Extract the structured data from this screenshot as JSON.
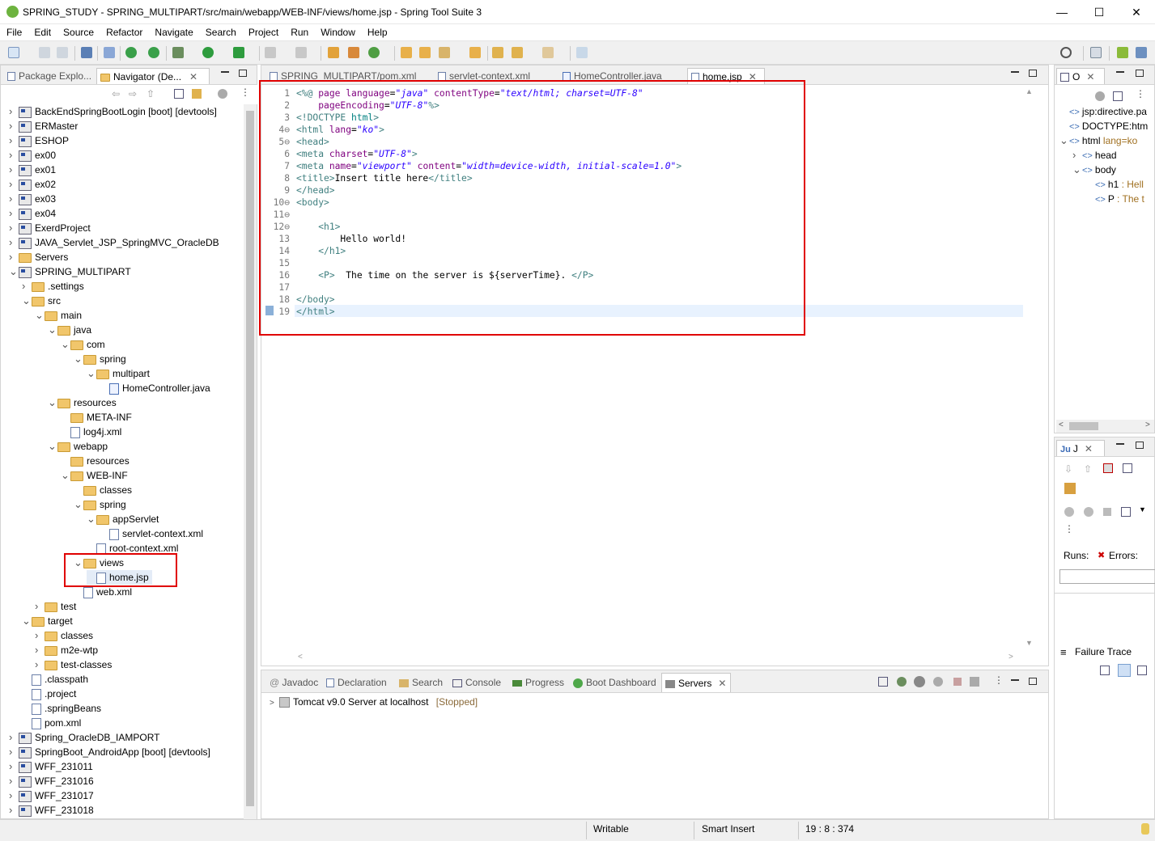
{
  "window": {
    "title": "SPRING_STUDY - SPRING_MULTIPART/src/main/webapp/WEB-INF/views/home.jsp - Spring Tool Suite 3",
    "min": "—",
    "max": "☐",
    "close": "✕"
  },
  "menu": [
    "File",
    "Edit",
    "Source",
    "Refactor",
    "Navigate",
    "Search",
    "Project",
    "Run",
    "Window",
    "Help"
  ],
  "left_tabs": {
    "package": "Package Explo...",
    "navigator": "Navigator (De..."
  },
  "tree": [
    {
      "label": "BackEndSpringBootLogin [boot] [devtools]",
      "level": 0,
      "icon": "proj",
      "tw": ">"
    },
    {
      "label": "ERMaster",
      "level": 0,
      "icon": "proj",
      "tw": ">"
    },
    {
      "label": "ESHOP",
      "level": 0,
      "icon": "proj",
      "tw": ">"
    },
    {
      "label": "ex00",
      "level": 0,
      "icon": "proj",
      "tw": ">"
    },
    {
      "label": "ex01",
      "level": 0,
      "icon": "proj",
      "tw": ">"
    },
    {
      "label": "ex02",
      "level": 0,
      "icon": "proj",
      "tw": ">"
    },
    {
      "label": "ex03",
      "level": 0,
      "icon": "proj",
      "tw": ">"
    },
    {
      "label": "ex04",
      "level": 0,
      "icon": "proj",
      "tw": ">"
    },
    {
      "label": "ExerdProject",
      "level": 0,
      "icon": "proj",
      "tw": ">"
    },
    {
      "label": "JAVA_Servlet_JSP_SpringMVC_OracleDB",
      "level": 0,
      "icon": "proj",
      "tw": ">"
    },
    {
      "label": "Servers",
      "level": 0,
      "icon": "fold",
      "tw": ">"
    },
    {
      "label": "SPRING_MULTIPART",
      "level": 0,
      "icon": "proj",
      "tw": "v"
    },
    {
      "label": ".settings",
      "level": 1,
      "icon": "fold",
      "tw": ">"
    },
    {
      "label": "src",
      "level": 1,
      "icon": "fold",
      "tw": "v"
    },
    {
      "label": "main",
      "level": 2,
      "icon": "fold",
      "tw": "v"
    },
    {
      "label": "java",
      "level": 3,
      "icon": "fold",
      "tw": "v"
    },
    {
      "label": "com",
      "level": 4,
      "icon": "fold",
      "tw": "v"
    },
    {
      "label": "spring",
      "level": 5,
      "icon": "fold",
      "tw": "v"
    },
    {
      "label": "multipart",
      "level": 6,
      "icon": "fold",
      "tw": "v"
    },
    {
      "label": "HomeController.java",
      "level": 7,
      "icon": "jfile",
      "tw": ""
    },
    {
      "label": "resources",
      "level": 3,
      "icon": "fold",
      "tw": "v"
    },
    {
      "label": "META-INF",
      "level": 4,
      "icon": "fold",
      "tw": ""
    },
    {
      "label": "log4j.xml",
      "level": 4,
      "icon": "file",
      "tw": ""
    },
    {
      "label": "webapp",
      "level": 3,
      "icon": "fold",
      "tw": "v"
    },
    {
      "label": "resources",
      "level": 4,
      "icon": "fold",
      "tw": ""
    },
    {
      "label": "WEB-INF",
      "level": 4,
      "icon": "fold",
      "tw": "v"
    },
    {
      "label": "classes",
      "level": 5,
      "icon": "fold",
      "tw": ""
    },
    {
      "label": "spring",
      "level": 5,
      "icon": "fold",
      "tw": "v"
    },
    {
      "label": "appServlet",
      "level": 6,
      "icon": "fold",
      "tw": "v"
    },
    {
      "label": "servlet-context.xml",
      "level": 7,
      "icon": "file",
      "tw": ""
    },
    {
      "label": "root-context.xml",
      "level": 6,
      "icon": "file",
      "tw": ""
    },
    {
      "label": "views",
      "level": 5,
      "icon": "fold",
      "tw": "v"
    },
    {
      "label": "home.jsp",
      "level": 6,
      "icon": "file",
      "tw": "",
      "selected": true
    },
    {
      "label": "web.xml",
      "level": 5,
      "icon": "file",
      "tw": ""
    },
    {
      "label": "test",
      "level": 2,
      "icon": "fold",
      "tw": ">"
    },
    {
      "label": "target",
      "level": 1,
      "icon": "fold",
      "tw": "v"
    },
    {
      "label": "classes",
      "level": 2,
      "icon": "fold",
      "tw": ">"
    },
    {
      "label": "m2e-wtp",
      "level": 2,
      "icon": "fold",
      "tw": ">"
    },
    {
      "label": "test-classes",
      "level": 2,
      "icon": "fold",
      "tw": ">"
    },
    {
      "label": ".classpath",
      "level": 1,
      "icon": "file",
      "tw": ""
    },
    {
      "label": ".project",
      "level": 1,
      "icon": "file",
      "tw": ""
    },
    {
      "label": ".springBeans",
      "level": 1,
      "icon": "file",
      "tw": ""
    },
    {
      "label": "pom.xml",
      "level": 1,
      "icon": "file",
      "tw": ""
    },
    {
      "label": "Spring_OracleDB_IAMPORT",
      "level": 0,
      "icon": "proj",
      "tw": ">"
    },
    {
      "label": "SpringBoot_AndroidApp [boot] [devtools]",
      "level": 0,
      "icon": "proj",
      "tw": ">"
    },
    {
      "label": "WFF_231011",
      "level": 0,
      "icon": "proj",
      "tw": ">"
    },
    {
      "label": "WFF_231016",
      "level": 0,
      "icon": "proj",
      "tw": ">"
    },
    {
      "label": "WFF_231017",
      "level": 0,
      "icon": "proj",
      "tw": ">"
    },
    {
      "label": "WFF_231018",
      "level": 0,
      "icon": "proj",
      "tw": ">"
    }
  ],
  "editor_tabs": [
    "SPRING_MULTIPART/pom.xml",
    "servlet-context.xml",
    "HomeController.java",
    "home.jsp"
  ],
  "code_lines": [
    {
      "n": "1",
      "tokens": [
        [
          "t",
          "<%@ "
        ],
        [
          "a",
          "page "
        ],
        [
          "a",
          "language"
        ],
        [
          "k",
          "="
        ],
        [
          "v",
          "\"java\""
        ],
        [
          "k",
          " "
        ],
        [
          "a",
          "contentType"
        ],
        [
          "k",
          "="
        ],
        [
          "v",
          "\"text/html; charset=UTF-8\""
        ]
      ]
    },
    {
      "n": "2",
      "tokens": [
        [
          "k",
          "    "
        ],
        [
          "a",
          "pageEncoding"
        ],
        [
          "k",
          "="
        ],
        [
          "v",
          "\"UTF-8\""
        ],
        [
          "t",
          "%>"
        ]
      ]
    },
    {
      "n": "3",
      "tokens": [
        [
          "t",
          "<!DOCTYPE "
        ],
        [
          "d",
          "html"
        ],
        [
          "t",
          ">"
        ]
      ]
    },
    {
      "n": "4⊖",
      "tokens": [
        [
          "t",
          "<html "
        ],
        [
          "a",
          "lang"
        ],
        [
          "k",
          "="
        ],
        [
          "v",
          "\"ko\""
        ],
        [
          "t",
          ">"
        ]
      ]
    },
    {
      "n": "5⊖",
      "tokens": [
        [
          "t",
          "<head>"
        ]
      ]
    },
    {
      "n": "6",
      "tokens": [
        [
          "t",
          "<meta "
        ],
        [
          "a",
          "charset"
        ],
        [
          "k",
          "="
        ],
        [
          "v",
          "\"UTF-8\""
        ],
        [
          "t",
          ">"
        ]
      ]
    },
    {
      "n": "7",
      "tokens": [
        [
          "t",
          "<meta "
        ],
        [
          "a",
          "name"
        ],
        [
          "k",
          "="
        ],
        [
          "v",
          "\"viewport\""
        ],
        [
          "k",
          " "
        ],
        [
          "a",
          "content"
        ],
        [
          "k",
          "="
        ],
        [
          "v",
          "\"width=device-width, initial-scale=1.0\""
        ],
        [
          "t",
          ">"
        ]
      ]
    },
    {
      "n": "8",
      "tokens": [
        [
          "t",
          "<title>"
        ],
        [
          "k",
          "Insert title here"
        ],
        [
          "t",
          "</title>"
        ]
      ]
    },
    {
      "n": "9",
      "tokens": [
        [
          "t",
          "</head>"
        ]
      ]
    },
    {
      "n": "10⊖",
      "tokens": [
        [
          "t",
          "<body>"
        ]
      ]
    },
    {
      "n": "11⊖",
      "tokens": []
    },
    {
      "n": "12⊖",
      "tokens": [
        [
          "k",
          "    "
        ],
        [
          "t",
          "<h1>"
        ]
      ]
    },
    {
      "n": "13",
      "tokens": [
        [
          "k",
          "        Hello world!"
        ]
      ]
    },
    {
      "n": "14",
      "tokens": [
        [
          "k",
          "    "
        ],
        [
          "t",
          "</h1>"
        ]
      ]
    },
    {
      "n": "15",
      "tokens": []
    },
    {
      "n": "16",
      "tokens": [
        [
          "k",
          "    "
        ],
        [
          "t",
          "<P>"
        ],
        [
          "k",
          "  The time on the server is ${serverTime}. "
        ],
        [
          "t",
          "</P>"
        ]
      ]
    },
    {
      "n": "17",
      "tokens": []
    },
    {
      "n": "18",
      "tokens": [
        [
          "t",
          "</body>"
        ]
      ]
    },
    {
      "n": "19",
      "tokens": [
        [
          "t",
          "</html>"
        ]
      ]
    }
  ],
  "outline": {
    "tab": "O",
    "items": [
      {
        "label": "jsp:directive.pa",
        "sub": "",
        "level": 0,
        "tw": ""
      },
      {
        "label": "DOCTYPE:htm",
        "sub": "",
        "level": 0,
        "tw": ""
      },
      {
        "label": "html",
        "sub": " lang=ko",
        "level": 0,
        "tw": "v"
      },
      {
        "label": "head",
        "sub": "",
        "level": 1,
        "tw": ">"
      },
      {
        "label": "body",
        "sub": "",
        "level": 1,
        "tw": "v"
      },
      {
        "label": "h1",
        "sub": " : Hell",
        "level": 2,
        "tw": ""
      },
      {
        "label": "P",
        "sub": " : The t",
        "level": 2,
        "tw": ""
      }
    ]
  },
  "junit": {
    "tab": "J",
    "runs": "Runs:",
    "errors": "Errors:",
    "failure_trace": "Failure Trace"
  },
  "bottom_tabs": [
    "Javadoc",
    "Declaration",
    "Search",
    "Console",
    "Progress",
    "Boot Dashboard",
    "Servers"
  ],
  "servers": [
    {
      "name": "Tomcat v9.0 Server at localhost",
      "state": "[Stopped]"
    }
  ],
  "status": {
    "writable": "Writable",
    "insert": "Smart Insert",
    "position": "19 : 8 : 374"
  }
}
